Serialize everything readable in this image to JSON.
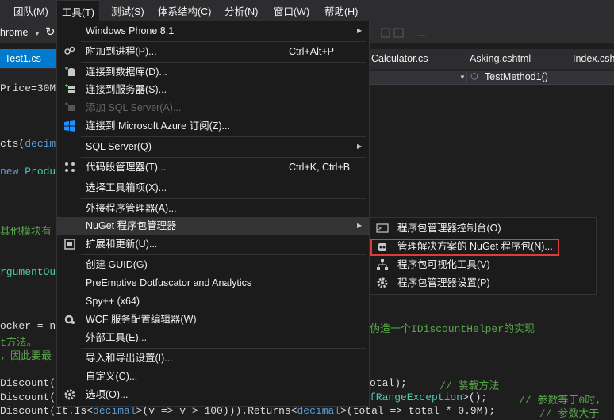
{
  "menubar": {
    "items": [
      "团队(M)",
      "工具(T)",
      "测试(S)",
      "体系结构(C)",
      "分析(N)",
      "窗口(W)",
      "帮助(H)"
    ]
  },
  "toolbar": {
    "browser_label": "hrome"
  },
  "tabs": {
    "active": "Test1.cs",
    "pin_glyph": "⊣",
    "others": [
      "Calculator.cs",
      "Asking.cshtml",
      "Index.csh"
    ]
  },
  "navbar": {
    "method": "TestMethod1()"
  },
  "code": {
    "l1": "Price=30M",
    "l2a": "cts(",
    "l2b": "decim",
    "l3a": "new ",
    "l3b": "Produ",
    "l4": "其他模块有",
    "l5": "rgumentOu",
    "l6a": "ocker = n",
    "l6b": "伪造一个IDiscountHelper的实现",
    "l7": "t方法。",
    "l8": "，因此要最",
    "l9a": "Discount(",
    "l9b": "otal);",
    "l9c": "// 装载方法",
    "l10a": "Discount(",
    "l10b": "fRangeException",
    "l10c": ">();",
    "l10d": "// 参数等于0时，",
    "l11a": "Discount(It.Is<",
    "l11b": "decimal",
    "l11c": ">(v => v > 100))).Returns<",
    "l11d": "decimal",
    "l11e": ">(total => total * 0.9M);",
    "l11f": "// 参数大于"
  },
  "tools_menu": {
    "windows_phone": "Windows Phone 8.1",
    "attach": "附加到进程(P)...",
    "attach_sc": "Ctrl+Alt+P",
    "connect_db": "连接到数据库(D)...",
    "connect_server": "连接到服务器(S)...",
    "add_sql": "添加 SQL Server(A)...",
    "azure": "连接到 Microsoft Azure 订阅(Z)...",
    "sql_server": "SQL Server(Q)",
    "snippets": "代码段管理器(T)...",
    "snippets_sc": "Ctrl+K, Ctrl+B",
    "toolbox": "选择工具箱项(X)...",
    "external_mgr": "外接程序管理器(A)...",
    "nuget": "NuGet 程序包管理器",
    "extensions": "扩展和更新(U)...",
    "guid": "创建 GUID(G)",
    "dotfuscator": "PreEmptive Dotfuscator and Analytics",
    "spy": "Spy++ (x64)",
    "wcf": "WCF 服务配置编辑器(W)",
    "external_tools": "外部工具(E)...",
    "import_export": "导入和导出设置(I)...",
    "customize": "自定义(C)...",
    "options": "选项(O)..."
  },
  "nuget_submenu": {
    "console": "程序包管理器控制台(O)",
    "manage": "管理解决方案的 NuGet 程序包(N)...",
    "visualize": "程序包可视化工具(V)",
    "settings": "程序包管理器设置(P)"
  },
  "colors": {
    "accent": "#007acc",
    "highlight_box": "#e03a3a"
  }
}
